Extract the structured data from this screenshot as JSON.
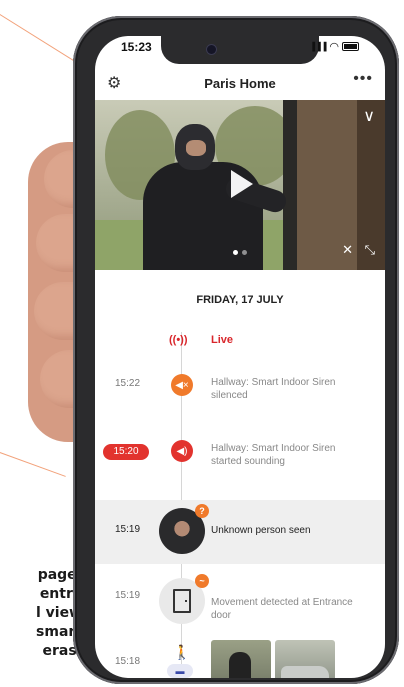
{
  "caption": {
    "lines": [
      "page.",
      "entry",
      "l view",
      "smart",
      "eras."
    ]
  },
  "status": {
    "time": "15:23",
    "signal": "▐▐▐",
    "wifi": "◠"
  },
  "header": {
    "title": "Paris Home",
    "settings_icon": "⚙",
    "more_icon": "•••"
  },
  "video": {
    "chevron": "∨",
    "mute_icon": "✕",
    "expand_icon": "⤡"
  },
  "timeline": {
    "date": "FRIDAY, 17 JULY",
    "live": {
      "icon": "((•))",
      "label": "Live"
    },
    "events": [
      {
        "time": "15:22",
        "icon": "◀×",
        "text_line1": "Hallway: Smart Indoor Siren",
        "text_line2": "silenced"
      },
      {
        "time": "15:20",
        "icon": "◀)",
        "text_line1": "Hallway: Smart Indoor Siren",
        "text_line2": "started sounding"
      },
      {
        "time": "15:19",
        "badge": "?",
        "text_line1": "Unknown person seen"
      },
      {
        "time": "15:19",
        "text_line1": "Movement detected at Entrance",
        "text_line2": "door"
      },
      {
        "time": "15:18",
        "walk_icon": "Ὣ6",
        "car_label": "▬"
      }
    ]
  },
  "colors": {
    "accent_orange": "#f07a2b",
    "alert_red": "#e2332e",
    "walk_teal": "#2bb6c8"
  }
}
